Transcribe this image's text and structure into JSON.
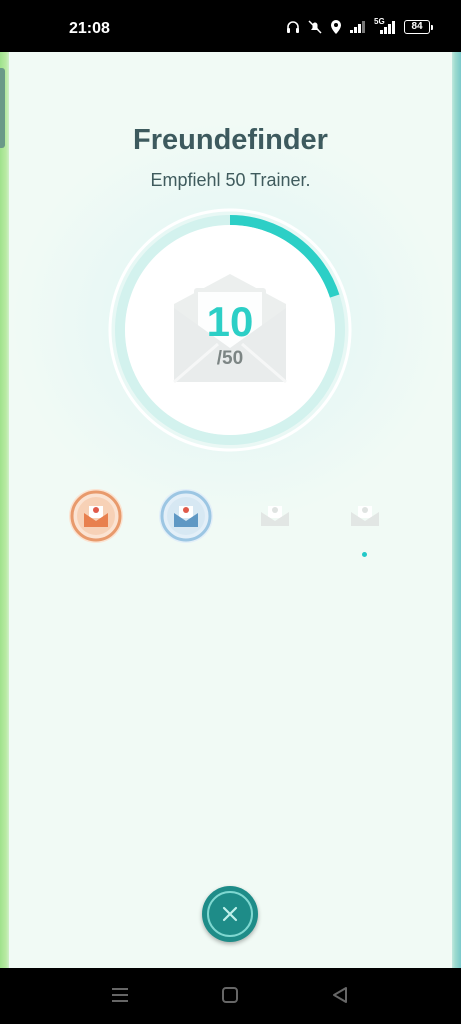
{
  "status_bar": {
    "time": "21:08",
    "signal_label": "5G",
    "battery": "84",
    "icons": [
      "headphones-icon",
      "mute-icon",
      "location-icon",
      "signal-icon",
      "signal-5g-icon",
      "battery-icon"
    ]
  },
  "medal": {
    "title": "Freundefinder",
    "subtitle": "Empfiehl 50 Trainer.",
    "current": "10",
    "goal": "/50",
    "progress_fraction": 0.2
  },
  "tiers": [
    {
      "name": "bronze",
      "unlocked": true,
      "color": "#e89a6c"
    },
    {
      "name": "silver",
      "unlocked": true,
      "color": "#7fb3d6"
    },
    {
      "name": "gold",
      "unlocked": false,
      "color": "#d6dcd8"
    },
    {
      "name": "platinum",
      "unlocked": false,
      "color": "#d6dcd8",
      "selected": true
    }
  ],
  "colors": {
    "accent": "#2ccfc6",
    "title": "#3d5a5e",
    "close_button": "#1e8c88"
  },
  "nav": {
    "icons": [
      "recent-apps-icon",
      "home-icon",
      "back-icon"
    ]
  }
}
